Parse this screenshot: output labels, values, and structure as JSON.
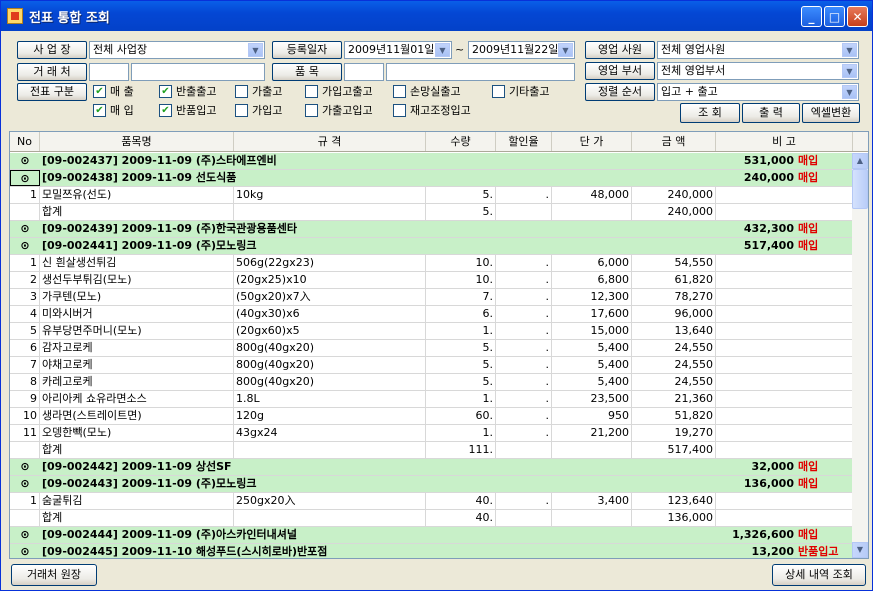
{
  "window": {
    "title": "전표 통합 조회",
    "min": "_",
    "max": "□",
    "close": "✕"
  },
  "filters": {
    "workplace_label": "사 업 장",
    "workplace_value": "전체 사업장",
    "client_label": "거 래 처",
    "client_code": "",
    "client_name": "",
    "slip_type_label": "전표 구분",
    "reg_date_label": "등록일자",
    "date_from": "2009년11월01일",
    "date_sep": "~",
    "date_to": "2009년11월22일",
    "item_label": "품     목",
    "item_code": "",
    "item_name": "",
    "sales_rep_label": "영업 사원",
    "sales_rep_value": "전체 영업사원",
    "sales_dept_label": "영업 부서",
    "sales_dept_value": "전체 영업부서",
    "sort_label": "정렬 순서",
    "sort_value": "입고 + 출고",
    "checkboxes": [
      {
        "label": "매 출",
        "checked": true
      },
      {
        "label": "반출출고",
        "checked": true
      },
      {
        "label": "가출고",
        "checked": false
      },
      {
        "label": "가입고출고",
        "checked": false
      },
      {
        "label": "손망실출고",
        "checked": false
      },
      {
        "label": "기타출고",
        "checked": false
      },
      {
        "label": "매 입",
        "checked": true
      },
      {
        "label": "반품입고",
        "checked": true
      },
      {
        "label": "가입고",
        "checked": false
      },
      {
        "label": "가출고입고",
        "checked": false
      },
      {
        "label": "재고조정입고",
        "checked": false
      }
    ],
    "search_btn": "조  회",
    "print_btn": "출  력",
    "excel_btn": "엑셀변환"
  },
  "grid": {
    "headers": [
      "No",
      "품목명",
      "규 격",
      "수량",
      "할인율",
      "단 가",
      "금 액",
      "비     고"
    ],
    "rows": [
      {
        "type": "grp",
        "title": "[09-002437]  2009-11-09  (주)스타에프엔비",
        "amount": "531,000",
        "note": "매입"
      },
      {
        "type": "grp",
        "title": "[09-002438]  2009-11-09  선도식품",
        "amount": "240,000",
        "note": "매입",
        "selected": true
      },
      {
        "type": "item",
        "no": "1",
        "name": "모밀쯔유(선도)",
        "spec": "10kg",
        "qty": "5.",
        "disc": ".",
        "price": "48,000",
        "amount": "240,000"
      },
      {
        "type": "item",
        "no": "",
        "name": "합계",
        "spec": "",
        "qty": "5.",
        "disc": "",
        "price": "",
        "amount": "240,000"
      },
      {
        "type": "grp",
        "title": "[09-002439]  2009-11-09  (주)한국관광용품센타",
        "amount": "432,300",
        "note": "매입"
      },
      {
        "type": "grp",
        "title": "[09-002441]  2009-11-09  (주)모노링크",
        "amount": "517,400",
        "note": "매입"
      },
      {
        "type": "item",
        "no": "1",
        "name": "신 흰살생선튀김",
        "spec": "506g(22gx23)",
        "qty": "10.",
        "disc": ".",
        "price": "6,000",
        "amount": "54,550"
      },
      {
        "type": "item",
        "no": "2",
        "name": "생선두부튀김(모노)",
        "spec": "(20gx25)x10",
        "qty": "10.",
        "disc": ".",
        "price": "6,800",
        "amount": "61,820"
      },
      {
        "type": "item",
        "no": "3",
        "name": "가쿠텐(모노)",
        "spec": "(50gx20)x7入",
        "qty": "7.",
        "disc": ".",
        "price": "12,300",
        "amount": "78,270"
      },
      {
        "type": "item",
        "no": "4",
        "name": "미와시버거",
        "spec": "(40gx30)x6",
        "qty": "6.",
        "disc": ".",
        "price": "17,600",
        "amount": "96,000"
      },
      {
        "type": "item",
        "no": "5",
        "name": "유부당면주머니(모노)",
        "spec": "(20gx60)x5",
        "qty": "1.",
        "disc": ".",
        "price": "15,000",
        "amount": "13,640"
      },
      {
        "type": "item",
        "no": "6",
        "name": "감자고로케",
        "spec": "800g(40gx20)",
        "qty": "5.",
        "disc": ".",
        "price": "5,400",
        "amount": "24,550"
      },
      {
        "type": "item",
        "no": "7",
        "name": "야채고로케",
        "spec": "800g(40gx20)",
        "qty": "5.",
        "disc": ".",
        "price": "5,400",
        "amount": "24,550"
      },
      {
        "type": "item",
        "no": "8",
        "name": "카레고로케",
        "spec": "800g(40gx20)",
        "qty": "5.",
        "disc": ".",
        "price": "5,400",
        "amount": "24,550"
      },
      {
        "type": "item",
        "no": "9",
        "name": "아리아케 쇼유라면소스",
        "spec": "1.8L",
        "qty": "1.",
        "disc": ".",
        "price": "23,500",
        "amount": "21,360"
      },
      {
        "type": "item",
        "no": "10",
        "name": "생라면(스트레이트면)",
        "spec": "120g",
        "qty": "60.",
        "disc": ".",
        "price": "950",
        "amount": "51,820"
      },
      {
        "type": "item",
        "no": "11",
        "name": "오뎅한빽(모노)",
        "spec": "43gx24",
        "qty": "1.",
        "disc": ".",
        "price": "21,200",
        "amount": "19,270"
      },
      {
        "type": "item",
        "no": "",
        "name": "합계",
        "spec": "",
        "qty": "111.",
        "disc": "",
        "price": "",
        "amount": "517,400"
      },
      {
        "type": "grp",
        "title": "[09-002442]  2009-11-09  상선SF",
        "amount": "32,000",
        "note": "매입"
      },
      {
        "type": "grp",
        "title": "[09-002443]  2009-11-09  (주)모노링크",
        "amount": "136,000",
        "note": "매입"
      },
      {
        "type": "item",
        "no": "1",
        "name": "숨굴튀김",
        "spec": "250gx20入",
        "qty": "40.",
        "disc": ".",
        "price": "3,400",
        "amount": "123,640"
      },
      {
        "type": "item",
        "no": "",
        "name": "합계",
        "spec": "",
        "qty": "40.",
        "disc": "",
        "price": "",
        "amount": "136,000"
      },
      {
        "type": "grp",
        "title": "[09-002444]  2009-11-09  (주)아스카인터내셔널",
        "amount": "1,326,600",
        "note": "매입"
      },
      {
        "type": "grp",
        "title": "[09-002445]  2009-11-10  해성푸드(스시히로바)반포점",
        "amount": "13,200",
        "note": "반품입고"
      }
    ]
  },
  "footer": {
    "ledger_btn": "거래처 원장",
    "detail_btn": "상세 내역 조회"
  },
  "colors": {
    "group_row": "#c8f0c8",
    "note_red": "#e00000",
    "title_blue": "#0447d4"
  }
}
